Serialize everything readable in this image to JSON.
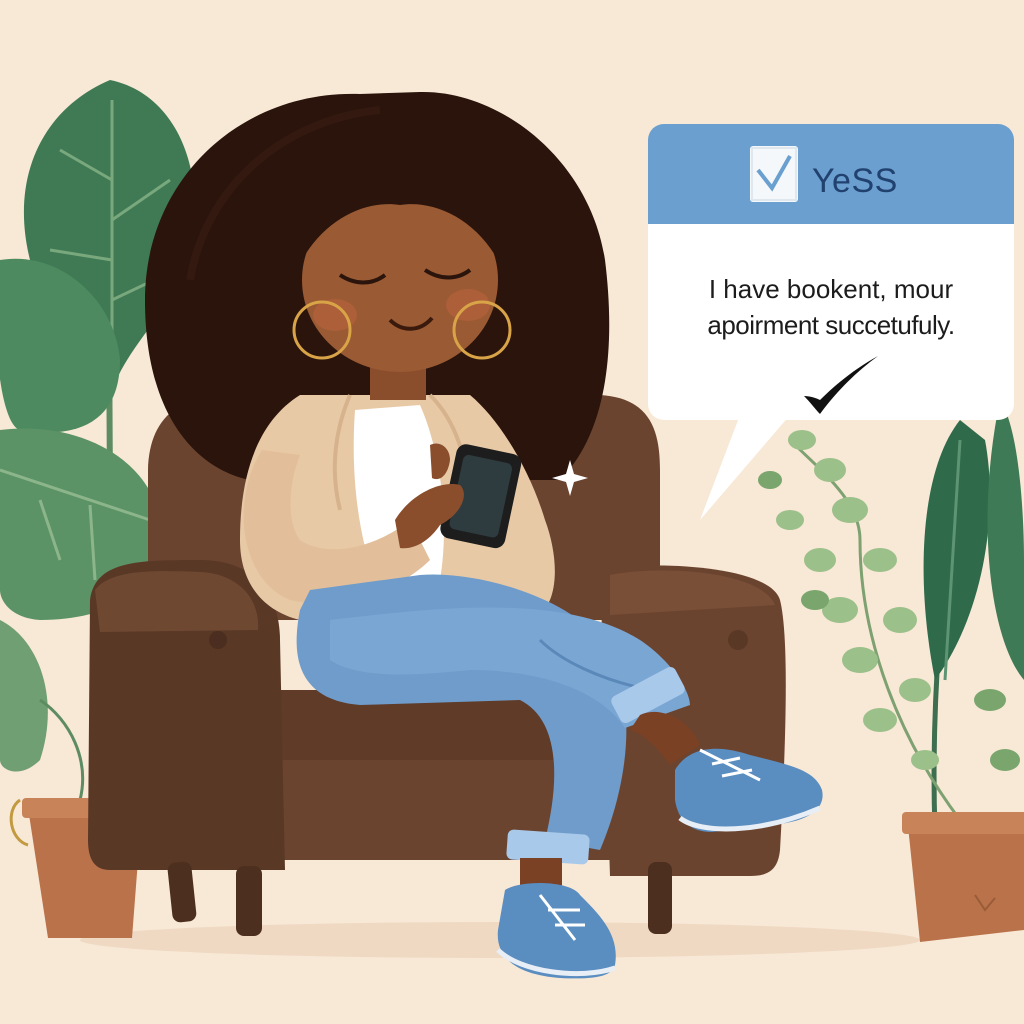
{
  "scene": {
    "description_icon": "woman-on-armchair-illustration"
  },
  "notification": {
    "header_label": "YeSS",
    "message_line_1": "I have bookent, mour",
    "message_line_2": "apoirment succetufuly.",
    "header_color": "#6a9fd0",
    "body_color": "#ffffff"
  },
  "colors": {
    "background": "#f8e8d6",
    "armchair": "#6b4430",
    "jeans": "#6f9ccb",
    "jacket": "#e8c9a6",
    "leaf_dark": "#3f7a55",
    "leaf_light": "#86b07c",
    "pot": "#b9724a"
  }
}
